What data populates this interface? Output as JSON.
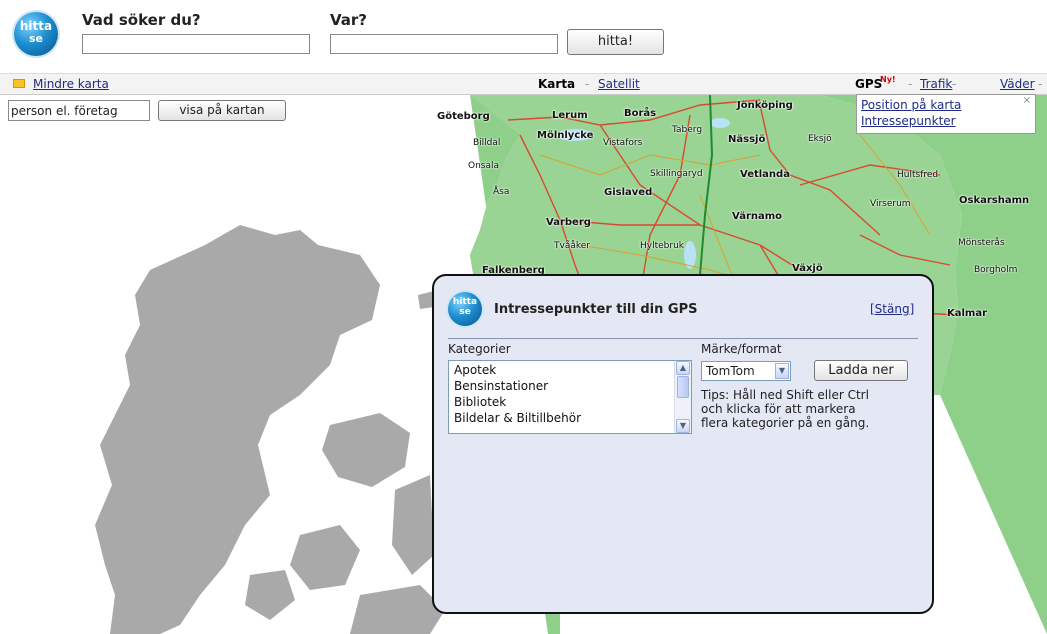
{
  "header": {
    "logo_line1": "hitta",
    "logo_line2": "se",
    "what_label": "Vad söker du?",
    "what_value": "",
    "where_label": "Var?",
    "where_value": "",
    "search_button": "hitta!"
  },
  "toolbar": {
    "smaller_map": "Mindre karta",
    "map_label": "Karta",
    "sep": "-",
    "satellite": "Satellit",
    "gps": "GPS",
    "gps_badge": "Ny!",
    "traffic": "Trafik",
    "weather": "Väder"
  },
  "search_row": {
    "placeholder": "person el. företag",
    "button": "visa på kartan"
  },
  "gps_menu": {
    "items": [
      "Position på karta",
      "Intressepunkter"
    ],
    "close": "×"
  },
  "map": {
    "towns": [
      "Göteborg",
      "Lerum",
      "Borås",
      "Jönköping",
      "Mölnlycke",
      "Taberg",
      "Nässjö",
      "Eksjö",
      "Billdal",
      "Vistafors",
      "Onsala",
      "Skillingaryd",
      "Vetlanda",
      "Hultsfred",
      "Åsa",
      "Gislaved",
      "Oskarshamn",
      "Virserum",
      "Varberg",
      "Värnamo",
      "Tvååker",
      "Hyltebruk",
      "Mönsterås",
      "Falkenberg",
      "Växjö",
      "Borgholm",
      "Kalmar"
    ]
  },
  "dialog": {
    "title": "Intressepunkter till din GPS",
    "close": "[Stäng]",
    "categories_label": "Kategorier",
    "categories": [
      "Apotek",
      "Bensinstationer",
      "Bibliotek",
      "Bildelar & Biltillbehör"
    ],
    "brand_label": "Märke/format",
    "brand_selected": "TomTom",
    "download_button": "Ladda ner",
    "tips": [
      "Tips: Håll ned Shift eller Ctrl",
      "och klicka för att markera",
      "flera kategorier på en gång."
    ]
  },
  "colors": {
    "land_gray": "#a9a9a9",
    "sweden_green": "#8ed08a",
    "water": "#ffffff",
    "dialog_bg": "#e4e7f4",
    "link": "#1f2b86"
  }
}
